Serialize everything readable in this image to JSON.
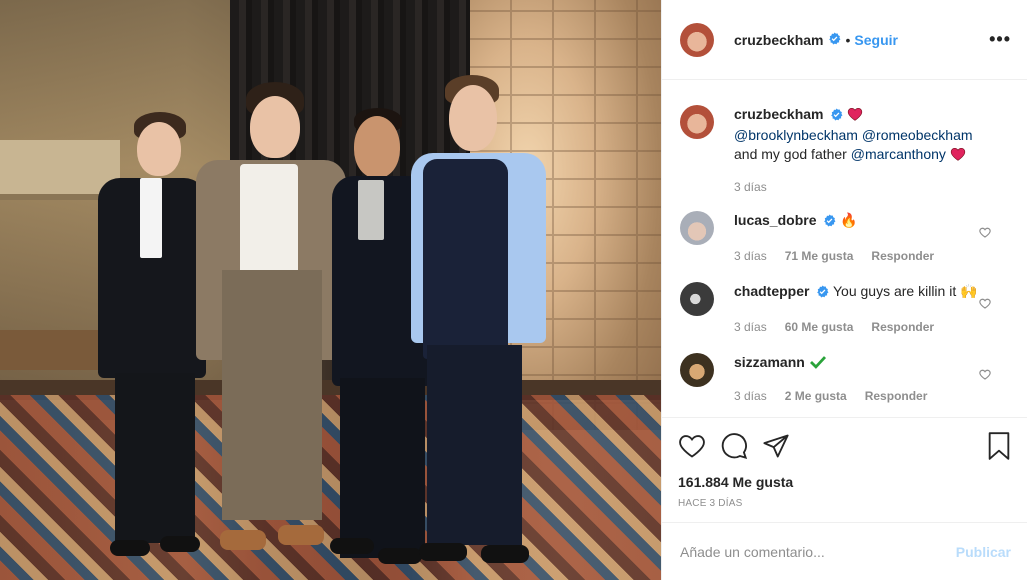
{
  "header": {
    "username": "cruzbeckham",
    "separator": "•",
    "follow_label": "Seguir",
    "more_label": "•••"
  },
  "caption": {
    "username": "cruzbeckham",
    "mentions": [
      "@brooklynbeckham",
      "@romeobeckham"
    ],
    "text": "and my god father",
    "last_mention": "@marcanthony",
    "emoji_heart": "❤️",
    "time": "3 días"
  },
  "comments": [
    {
      "username": "lucas_dobre",
      "verified": true,
      "text": "🔥",
      "time": "3 días",
      "likes": "71 Me gusta",
      "reply": "Responder"
    },
    {
      "username": "chadtepper",
      "verified": true,
      "text": "You guys are killin it 🙌",
      "time": "3 días",
      "likes": "60 Me gusta",
      "reply": "Responder"
    },
    {
      "username": "sizzamann",
      "verified": false,
      "text": "✔️",
      "time": "3 días",
      "likes": "2 Me gusta",
      "reply": "Responder"
    }
  ],
  "actions": {
    "likes": "161.884 Me gusta",
    "date": "HACE 3 DÍAS"
  },
  "add_comment": {
    "placeholder": "Añade un comentario...",
    "publish_label": "Publicar"
  },
  "colors": {
    "accent": "#3897f0",
    "verified": "#3897f0",
    "heart": "#ed4956",
    "publish_disabled": "#b9dcfb"
  },
  "icons": [
    "verified-badge-icon",
    "heart-icon",
    "comment-icon",
    "share-icon",
    "bookmark-icon",
    "more-options-icon"
  ]
}
